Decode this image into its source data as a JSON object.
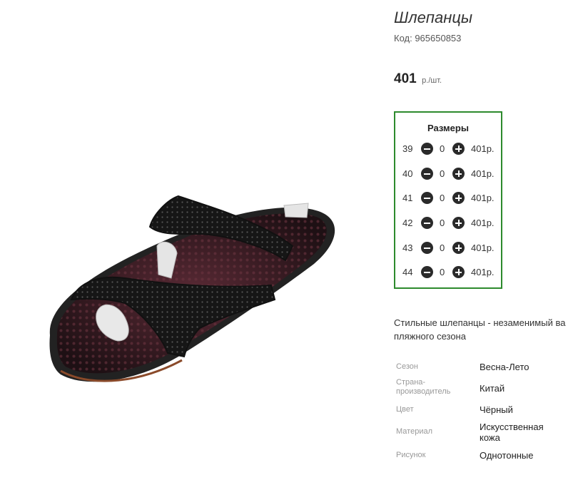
{
  "product": {
    "title": "Шлепанцы",
    "code": "Код: 965650853",
    "price_value": "401",
    "price_unit": "р./шт.",
    "image_icon": "black-slide-sandal-image"
  },
  "sizes": {
    "title": "Размеры",
    "rows": [
      {
        "size": "39",
        "qty": "0",
        "price": "401р."
      },
      {
        "size": "40",
        "qty": "0",
        "price": "401р."
      },
      {
        "size": "41",
        "qty": "0",
        "price": "401р."
      },
      {
        "size": "42",
        "qty": "0",
        "price": "401р."
      },
      {
        "size": "43",
        "qty": "0",
        "price": "401р."
      },
      {
        "size": "44",
        "qty": "0",
        "price": "401р."
      }
    ]
  },
  "description": {
    "line1": "Стильные шлепанцы - незаменимый ва",
    "line2": "пляжного сезона"
  },
  "attributes": [
    {
      "label": "Сезон",
      "value": "Весна-Лето"
    },
    {
      "label": "Страна-\nпроизводитель",
      "value": "Китай"
    },
    {
      "label": "Цвет",
      "value": "Чёрный"
    },
    {
      "label": "Материал",
      "value": "Искусственная\nкожа"
    },
    {
      "label": "Рисунок",
      "value": "Однотонные"
    }
  ],
  "colors": {
    "accent_border": "#2d8a2d",
    "button": "#2a2a2a"
  }
}
